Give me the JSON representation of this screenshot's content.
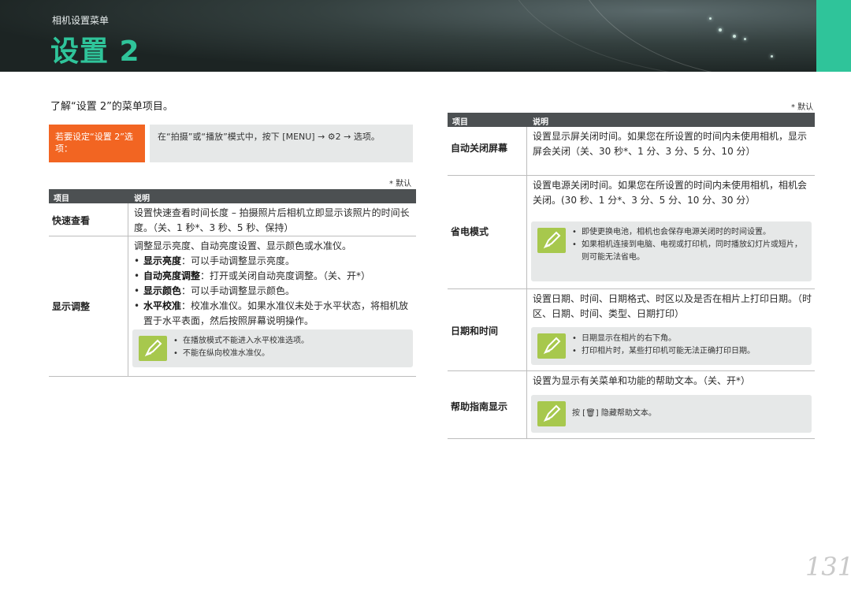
{
  "header": {
    "subtitle": "相机设置菜单",
    "title": "设置 2"
  },
  "intro": "了解“设置 2”的菜单项目。",
  "callout": {
    "label": "若要设定“设置 2”选项：",
    "body": "在“拍摄”或“播放”模式中，按下 [MENU] → ⚙2 → 选项。"
  },
  "default_note": "* 默认",
  "left_table": {
    "col_item": "项目",
    "col_desc": "说明",
    "rows": [
      {
        "name": "快速查看",
        "desc": "设置快速查看时间长度 – 拍摄照片后相机立即显示该照片的时间长度。（关、1 秒*、3 秒、5 秒、保持）"
      },
      {
        "name": "显示调整",
        "desc": "调整显示亮度、自动亮度设置、显示颜色或水准仪。",
        "bullets": [
          {
            "term": "显示亮度",
            "text": "：可以手动调整显示亮度。"
          },
          {
            "term": "自动亮度调整",
            "text": "：打开或关闭自动亮度调整。（关、开*）"
          },
          {
            "term": "显示颜色",
            "text": "：可以手动调整显示颜色。"
          },
          {
            "term": "水平校准",
            "text": "：校准水准仪。如果水准仪未处于水平状态，将相机放置于水平表面，然后按照屏幕说明操作。"
          }
        ],
        "notes": [
          "在播放模式不能进入水平校准选项。",
          "不能在纵向校准水准仪。"
        ]
      }
    ]
  },
  "right_table": {
    "col_item": "项目",
    "col_desc": "说明",
    "rows": [
      {
        "name": "自动关闭屏幕",
        "desc": "设置显示屏关闭时间。如果您在所设置的时间内未使用相机，显示屏会关闭（关、30 秒*、1 分、3 分、5 分、10 分）"
      },
      {
        "name": "省电模式",
        "desc": "设置电源关闭时间。如果您在所设置的时间内未使用相机，相机会关闭。(30 秒、1 分*、3 分、5 分、10 分、30 分）",
        "notes": [
          "即使更换电池，相机也会保存电源关闭时的时间设置。",
          "如果相机连接到电脑、电视或打印机，同时播放幻灯片或短片，则可能无法省电。"
        ]
      },
      {
        "name": "日期和时间",
        "desc": "设置日期、时间、日期格式、时区以及是否在相片上打印日期。（时区、日期、时间、类型、日期打印）",
        "notes": [
          "日期显示在相片的右下角。",
          "打印相片时，某些打印机可能无法正确打印日期。"
        ]
      },
      {
        "name": "帮助指南显示",
        "desc": "设置为显示有关菜单和功能的帮助文本。（关、开*）",
        "note": "按 [🗑] 隐藏帮助文本。"
      }
    ]
  },
  "page_number": "131",
  "colors": {
    "accent_green": "#2fc49a",
    "callout_orange": "#f26522",
    "note_icon_green": "#a7c84d",
    "table_header": "#4c5052"
  },
  "icons": [
    "note-pen-icon",
    "settings-gear-icon",
    "trash-icon"
  ]
}
